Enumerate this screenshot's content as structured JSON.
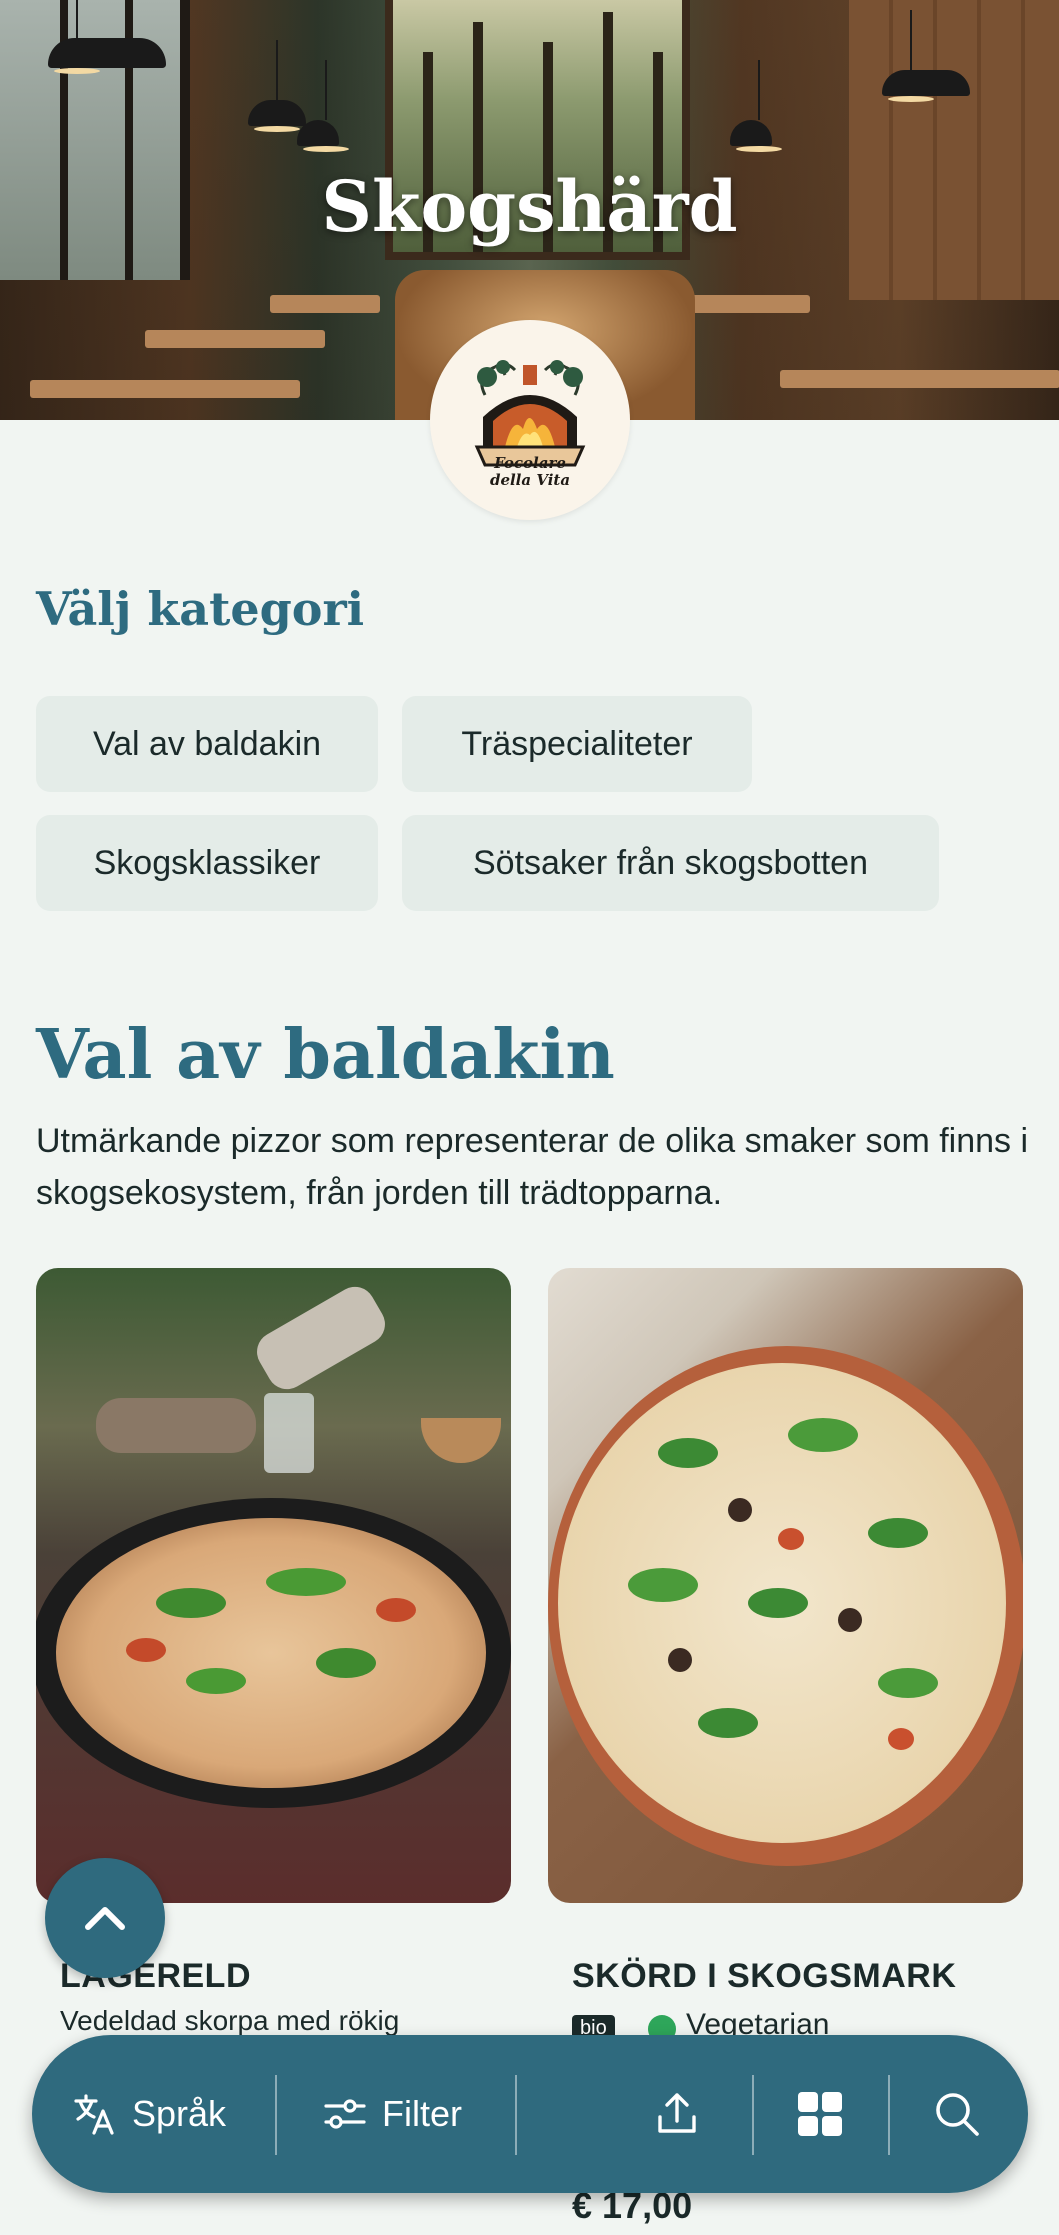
{
  "restaurant": {
    "name": "Skogshärd"
  },
  "logo": {
    "line1": "Focolare",
    "line2": "della Vita"
  },
  "categories": {
    "heading": "Välj kategori",
    "chips": [
      {
        "label": "Val av baldakin"
      },
      {
        "label": "Träspecialiteter"
      },
      {
        "label": "Skogsklassiker"
      },
      {
        "label": "Sötsaker från skogsbotten"
      }
    ]
  },
  "section": {
    "title": "Val av baldakin",
    "description": "Utmärkande pizzor som representerar de olika smaker som finns i skogsekosystem, från jorden till trädtopparna."
  },
  "items": [
    {
      "name": "LÄGERELD",
      "description": "Vedeldad skorpa med rökig",
      "tags": []
    },
    {
      "name": "SKÖRD I SKOGSMARK",
      "tags": [
        "bio",
        "Vegetarian"
      ],
      "price": "€ 17,00"
    }
  ],
  "bottom_bar": {
    "language_label": "Språk",
    "filter_label": "Filter"
  },
  "colors": {
    "accent": "#2f6a7e",
    "heading": "#2e6b80",
    "background": "#f1f5f2",
    "chip": "#e4ece8"
  }
}
